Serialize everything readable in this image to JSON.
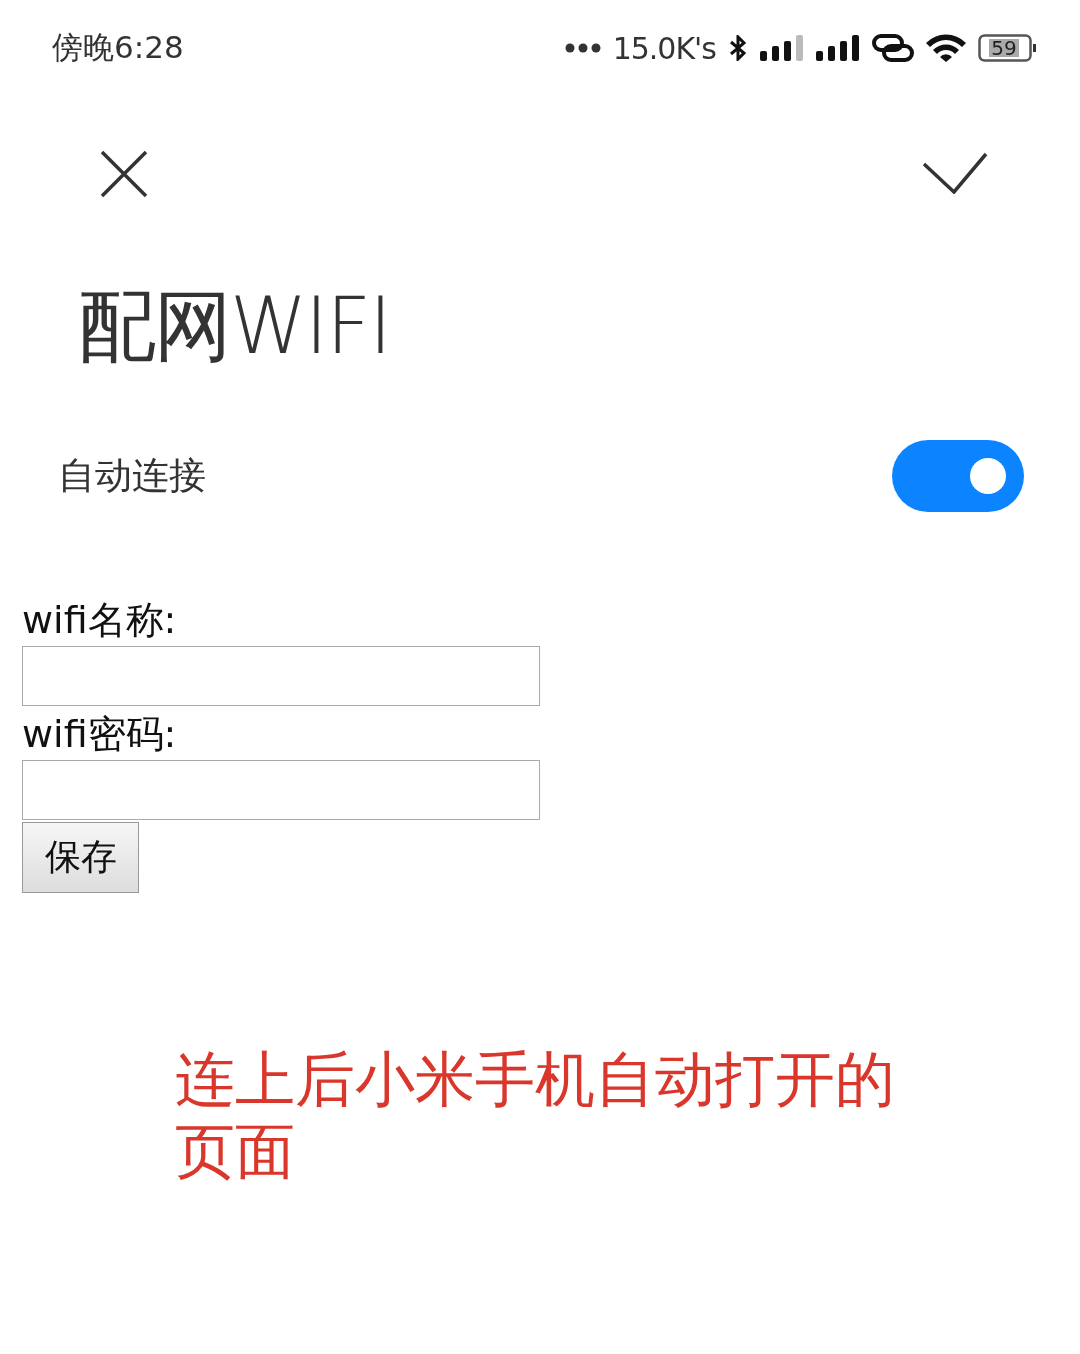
{
  "status_bar": {
    "time": "傍晚6:28",
    "speed": "15.0K's",
    "battery": "59"
  },
  "title": "配网WIFI",
  "auto_connect": {
    "label": "自动连接",
    "on": true
  },
  "form": {
    "fields": [
      {
        "label": "wifi名称:"
      },
      {
        "label": "wifi密码:"
      }
    ],
    "button": "保存"
  },
  "annotation": "连上后小米手机自动打开的页面"
}
